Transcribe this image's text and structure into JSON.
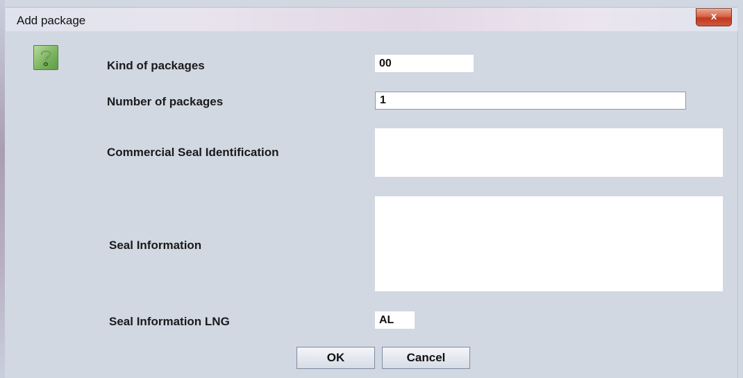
{
  "window": {
    "title": "Add package",
    "close_glyph": "x"
  },
  "icon": "question-icon",
  "form": {
    "kind_label": "Kind of packages",
    "kind_value": "00",
    "number_label": "Number of packages",
    "number_value": "1",
    "commercial_seal_label": "Commercial Seal Identification",
    "commercial_seal_value": "",
    "seal_info_label": "Seal Information",
    "seal_info_value": "",
    "seal_lng_label": "Seal Information LNG",
    "seal_lng_value": "AL"
  },
  "buttons": {
    "ok": "OK",
    "cancel": "Cancel"
  },
  "colors": {
    "background": "#d2d8e2",
    "close_button": "#c94a2e"
  }
}
